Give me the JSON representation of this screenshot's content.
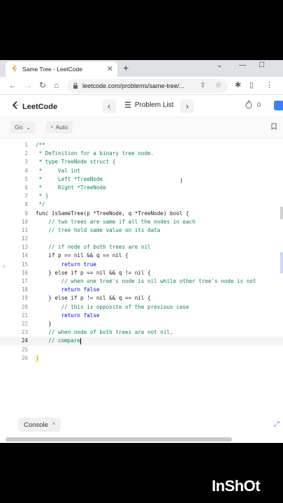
{
  "browser": {
    "tab_title": "Same Tree - LeetCode",
    "url": "leetcode.com/problems/same-tree/..."
  },
  "lc": {
    "brand": "LeetCode",
    "problem_list_label": "Problem List",
    "streak_count": "0"
  },
  "editor": {
    "language": "Go",
    "mode": "Auto"
  },
  "code_lines": [
    "/**",
    " * Definition for a binary tree node.",
    " * type TreeNode struct {",
    " *     Val int",
    " *     Left *TreeNode",
    " *     Right *TreeNode",
    " * }",
    " */",
    "func isSameTree(p *TreeNode, q *TreeNode) bool {",
    "    // two trees are same if all the nodes in each",
    "    // tree hold same value on its data",
    "",
    "    // if node of both trees are nil",
    "    if p == nil && q == nil {",
    "        return true",
    "    } else if p == nil && q != nil {",
    "        // when one tree's node is nil while other tree's node is not",
    "        return false",
    "    } else if p != nil && q == nil {",
    "        // this is opposite of the previous case",
    "        return false",
    "    }",
    "    // when node of both trees are not nil,",
    "    // compare",
    "",
    "}"
  ],
  "console": {
    "label": "Console"
  },
  "watermark": "InShOt"
}
